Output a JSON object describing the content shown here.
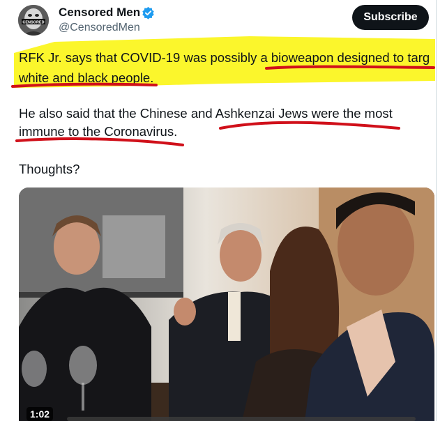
{
  "author": {
    "display_name": "Censored Men",
    "handle": "@CensoredMen",
    "avatar_icon": "masked-face-avatar",
    "avatar_text": "CENSORED",
    "verified_icon": "verified-badge-icon",
    "verified_color": "#1d9bf0"
  },
  "subscribe_label": "Subscribe",
  "tweet": {
    "line1": "RFK Jr. says that COVID-19 was possibly a bioweapon designed to targ",
    "line2a": "white and black people",
    "line2b": ".",
    "line3": "He also said that the Chinese and Ashkenzai Jews were the most",
    "line4": "immune to the Coronavirus.",
    "line5": "Thoughts?"
  },
  "annotations": {
    "highlight_color": "#fbf51a",
    "underline_color": "#d0101a"
  },
  "media": {
    "type": "video",
    "duration": "1:02"
  }
}
